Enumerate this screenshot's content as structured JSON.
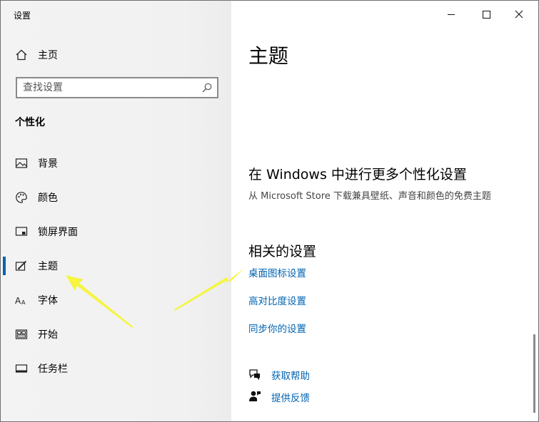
{
  "window": {
    "title": "设置"
  },
  "sidebar": {
    "home_label": "主页",
    "search_placeholder": "查找设置",
    "section_title": "个性化",
    "items": [
      {
        "label": "背景",
        "icon": "picture-icon"
      },
      {
        "label": "颜色",
        "icon": "palette-icon"
      },
      {
        "label": "锁屏界面",
        "icon": "lock-screen-icon"
      },
      {
        "label": "主题",
        "icon": "theme-brush-icon",
        "selected": true
      },
      {
        "label": "字体",
        "icon": "font-icon"
      },
      {
        "label": "开始",
        "icon": "start-icon"
      },
      {
        "label": "任务栏",
        "icon": "taskbar-icon"
      }
    ]
  },
  "content": {
    "page_title": "主题",
    "store_heading": "在 Windows 中进行更多个性化设置",
    "store_subtext": "从 Microsoft Store 下载兼具壁纸、声音和颜色的免费主题",
    "related_heading": "相关的设置",
    "related_links": [
      "桌面图标设置",
      "高对比度设置",
      "同步你的设置"
    ],
    "help_links": [
      {
        "label": "获取帮助",
        "icon": "get-help-icon"
      },
      {
        "label": "提供反馈",
        "icon": "feedback-icon"
      }
    ]
  },
  "colors": {
    "accent": "#0063b1",
    "arrow": "#f5f542",
    "sidebar_bg": "#f2f2f2"
  }
}
